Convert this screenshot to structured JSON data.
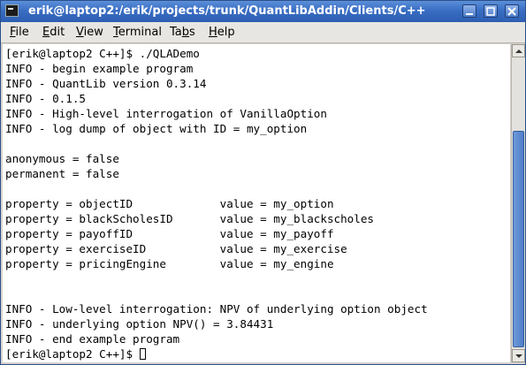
{
  "window": {
    "title": "erik@laptop2:/erik/projects/trunk/QuantLibAddin/Clients/C++",
    "icon": "terminal-icon"
  },
  "menubar": {
    "items": [
      {
        "accel": "F",
        "rest": "ile"
      },
      {
        "accel": "E",
        "rest": "dit"
      },
      {
        "accel": "V",
        "rest": "iew"
      },
      {
        "accel": "T",
        "rest": "erminal"
      },
      {
        "accel": "",
        "pre": "Ta",
        "mid": "b",
        "rest": "s"
      },
      {
        "accel": "H",
        "rest": "elp"
      }
    ]
  },
  "terminal": {
    "lines": [
      "[erik@laptop2 C++]$ ./QLADemo",
      "INFO - begin example program",
      "INFO - QuantLib version 0.3.14",
      "INFO - 0.1.5",
      "INFO - High-level interrogation of VanillaOption",
      "INFO - log dump of object with ID = my_option",
      "",
      "anonymous = false",
      "permanent = false",
      "",
      "property = objectID             value = my_option",
      "property = blackScholesID       value = my_blackscholes",
      "property = payoffID             value = my_payoff",
      "property = exerciseID           value = my_exercise",
      "property = pricingEngine        value = my_engine",
      "",
      "",
      "INFO - Low-level interrogation: NPV of underlying option object",
      "INFO - underlying option NPV() = 3.84431",
      "INFO - end example program"
    ],
    "prompt": "[erik@laptop2 C++]$ "
  },
  "scrollbar": {
    "position_fraction": 1.0,
    "visible_fraction": 0.71
  }
}
